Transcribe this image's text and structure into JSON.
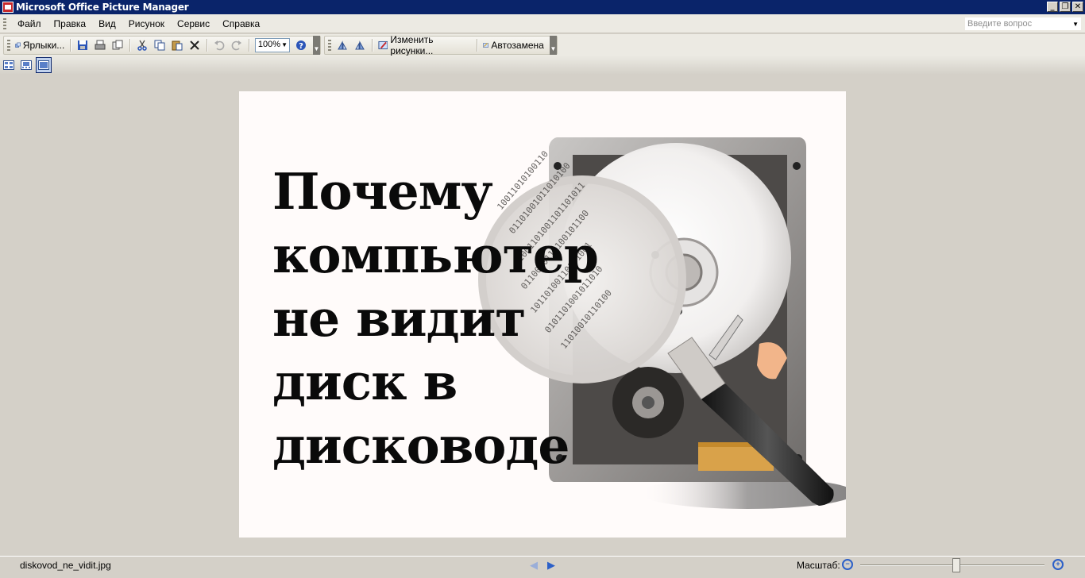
{
  "window": {
    "title": "Microsoft Office Picture Manager",
    "buttons": [
      "_",
      "❐",
      "✕"
    ]
  },
  "menu": {
    "items": [
      "Файл",
      "Правка",
      "Вид",
      "Рисунок",
      "Сервис",
      "Справка"
    ],
    "ask_placeholder": "Введите вопрос"
  },
  "toolbar": {
    "shortcuts_label": "Ярлыки...",
    "zoom_value": "100%",
    "edit_pictures_label": "Изменить рисунки...",
    "autocorrect_label": "Автозамена"
  },
  "picture": {
    "text_lines": [
      "Почему",
      "компьютер",
      "не видит",
      "диск в",
      "дисководе"
    ]
  },
  "status": {
    "filename": "diskovod_ne_vidit.jpg",
    "zoom_label": "Масштаб:",
    "zoom_level": 0.52
  },
  "colors": {
    "titlebar": "#0a246a",
    "accent": "#2c60c8"
  }
}
